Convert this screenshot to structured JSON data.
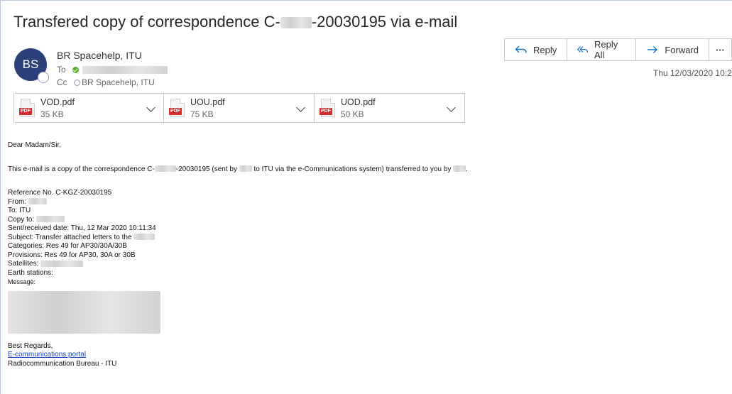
{
  "subject": {
    "prefix": "Transfered copy of correspondence C-",
    "suffix": "-20030195 via e-mail"
  },
  "sender": {
    "initials": "BS",
    "name": "BR Spacehelp, ITU"
  },
  "recipients": {
    "to_label": "To",
    "cc_label": "Cc",
    "cc_name": "BR Spacehelp, ITU"
  },
  "actions": {
    "reply": "Reply",
    "reply_all": "Reply All",
    "forward": "Forward",
    "more": "···"
  },
  "timestamp": "Thu 12/03/2020 10:2",
  "attachments": [
    {
      "name": "VOD.pdf",
      "size": "35 KB",
      "type_tag": "PDF"
    },
    {
      "name": "UOU.pdf",
      "size": "75 KB",
      "type_tag": "PDF"
    },
    {
      "name": "UOD.pdf",
      "size": "50 KB",
      "type_tag": "PDF"
    }
  ],
  "body": {
    "greeting": "Dear Madam/Sir,",
    "intro_1": "This e-mail is a copy of the correspondence C-",
    "intro_2": "-20030195 (sent by",
    "intro_3": "to ITU via the e-Communications system) transferred to you by",
    "intro_4": ".",
    "reference": "Reference No. C-KGZ-20030195",
    "from": "From:",
    "to": "To: ITU",
    "copy_to": "Copy to:",
    "sent_received": "Sent/received date: Thu, 12 Mar 2020 10:11:34",
    "subject_line": "Subject: Transfer attached letters to the",
    "categories": "Categories: Res 49 for AP30/30A/30B",
    "provisions": "Provisions: Res 49 for AP30, 30A or 30B",
    "satellites": "Satellites:",
    "earth_stations": "Earth stations:",
    "message": "Message:",
    "closing": "Best Regards,",
    "portal_link": "E-communications portal",
    "signature": "Radiocommunication Bureau - ITU"
  },
  "colors": {
    "avatar": "#2b3f78",
    "accent": "#1a73c9",
    "pdf_red": "#d32f2f",
    "presence_green": "#5cad2c",
    "link": "#1a43c9"
  }
}
